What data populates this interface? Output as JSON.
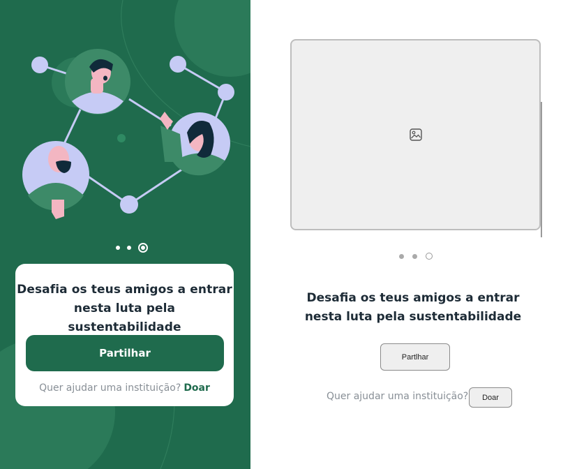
{
  "left": {
    "pagination": {
      "count": 3,
      "active_index": 2
    },
    "card": {
      "title_line1": "Desafia os teus amigos a entrar",
      "title_line2": "nesta luta pela sustentabilidade",
      "share_label": "Partilhar",
      "help_text": "Quer ajudar uma instituição?",
      "donate_label": "Doar"
    }
  },
  "right": {
    "image_icon": "image-placeholder-icon",
    "pagination": {
      "count": 3,
      "active_index": 2
    },
    "title_line1": "Desafia os teus amigos a entrar",
    "title_line2": "nesta luta pela sustentabilidade",
    "share_label": "Partlhar",
    "help_text": "Quer ajudar uma instituição?",
    "donate_label": "Doar"
  },
  "colors": {
    "brand_green": "#1f6b4d",
    "light_green": "#3d8a68",
    "lavender": "#c6cbf5",
    "text_dark": "#1d2b36",
    "text_muted": "#888f96"
  }
}
